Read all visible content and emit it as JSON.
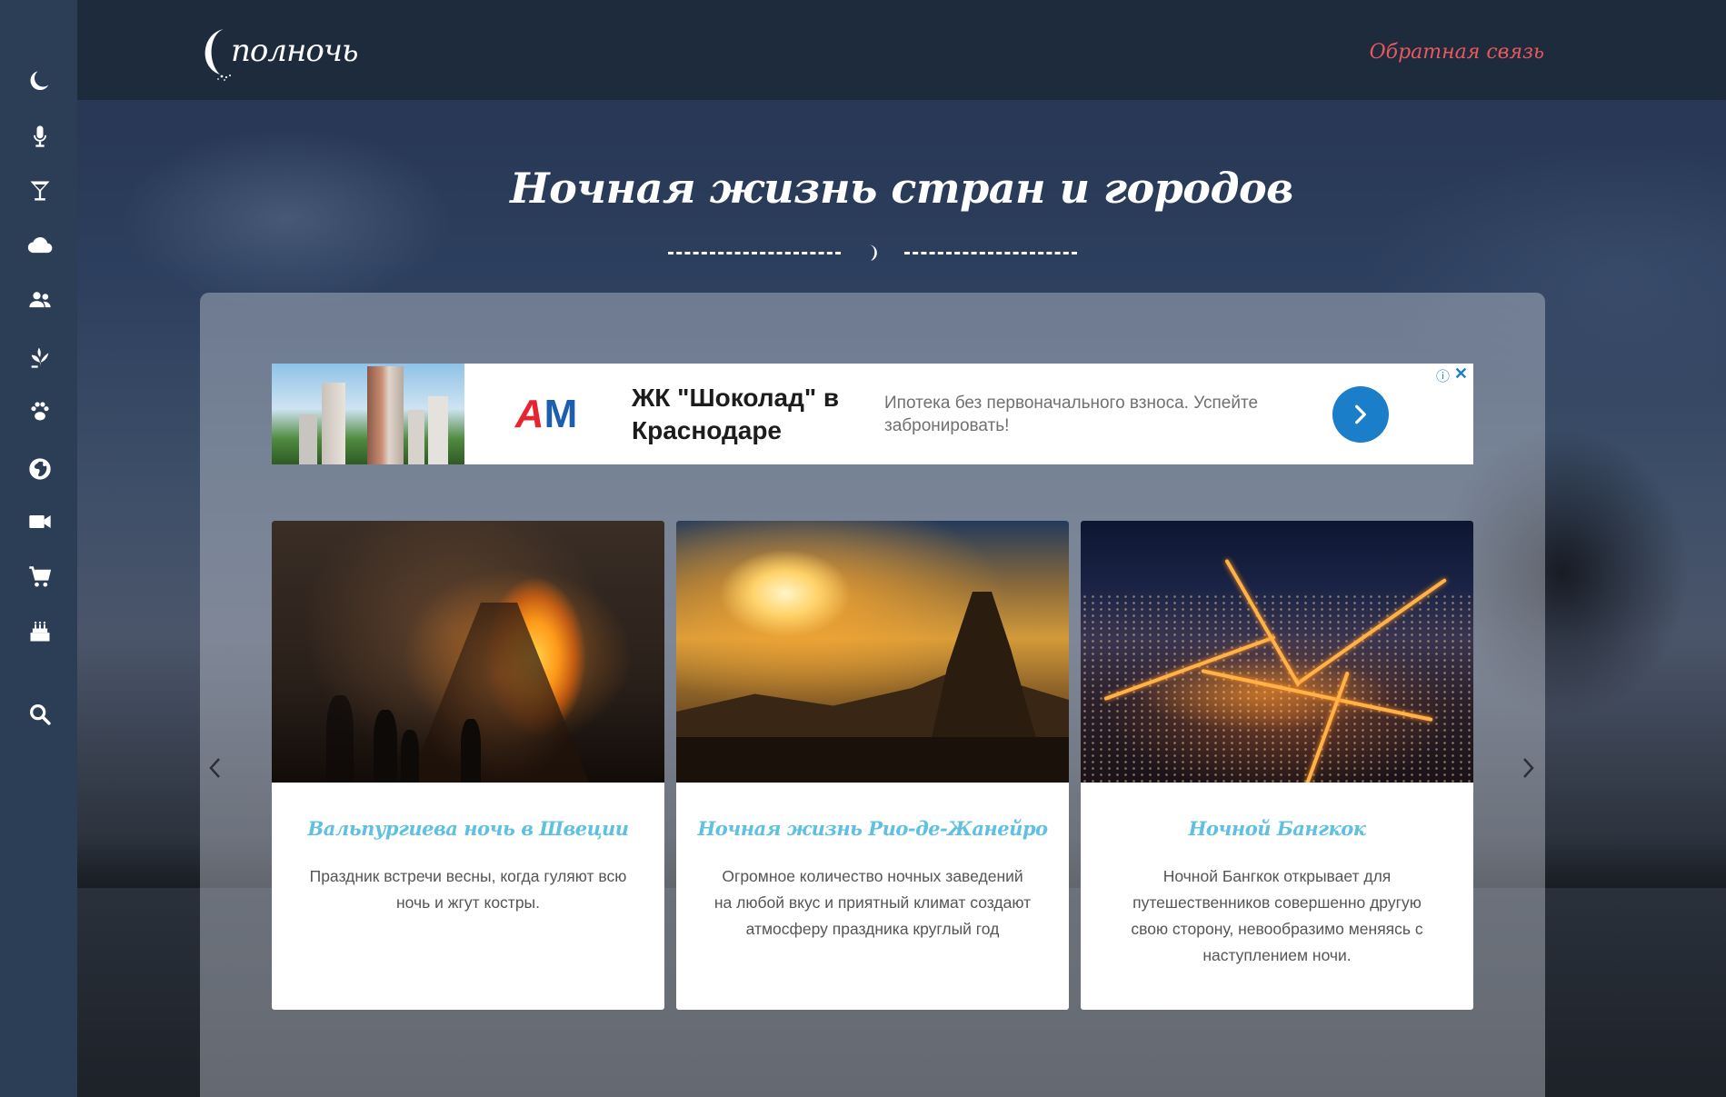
{
  "header": {
    "logo_text": "полночь",
    "feedback_label": "Обратная связь"
  },
  "sidebar": {
    "items": [
      {
        "icon": "moon-icon"
      },
      {
        "icon": "microphone-icon"
      },
      {
        "icon": "cocktail-icon"
      },
      {
        "icon": "cloud-icon"
      },
      {
        "icon": "people-icon"
      },
      {
        "icon": "plant-icon"
      },
      {
        "icon": "paw-icon"
      },
      {
        "icon": "globe-icon"
      },
      {
        "icon": "video-camera-icon"
      },
      {
        "icon": "shopping-cart-icon"
      },
      {
        "icon": "birthday-cake-icon"
      },
      {
        "icon": "search-icon"
      }
    ]
  },
  "main": {
    "title": "Ночная жизнь стран и городов"
  },
  "ad": {
    "brand": "AM",
    "headline": "ЖК \"Шоколад\" в Краснодаре",
    "description": "Ипотека без первоначального взноса. Успейте забронировать!",
    "info_icon": "ⓘ",
    "close_icon": "✕"
  },
  "cards": [
    {
      "title": "Вальпургиева ночь в Швеции",
      "text": "Праздник встречи весны, когда гуляют всю ночь и жгут костры."
    },
    {
      "title": "Ночная жизнь Рио-де-Жанейро",
      "text": "Огромное количество ночных заведений на любой вкус и приятный климат создают атмосферу праздника круглый год"
    },
    {
      "title": "Ночной Бангкок",
      "text": "Ночной Бангкок открывает для путешественников совершенно другую свою сторону, невообразимо меняясь с наступлением ночи."
    }
  ],
  "colors": {
    "sidebar_bg": "#2c3e55",
    "header_bg": "#1e2b3d",
    "feedback_link": "#e8585f",
    "card_title": "#5fc0e0",
    "ad_accent": "#1a7ec9"
  }
}
